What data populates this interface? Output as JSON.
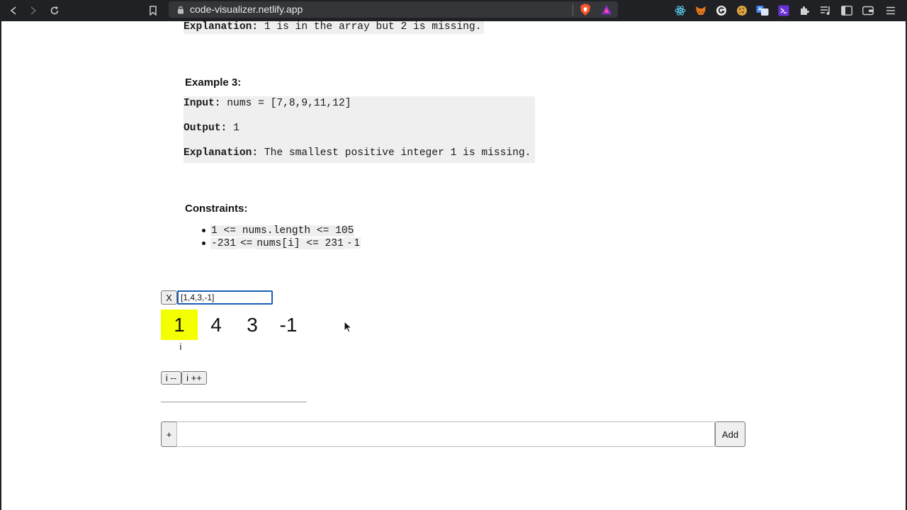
{
  "browser": {
    "url": "code-visualizer.netlify.app"
  },
  "problem": {
    "example2_explanation_label": "Explanation:",
    "example2_explanation_text": " 1 is in the array but 2 is missing.",
    "example3": {
      "heading": "Example 3:",
      "input_label": "Input:",
      "input_text": " nums = [7,8,9,11,12]",
      "output_label": "Output:",
      "output_text": " 1",
      "explanation_label": "Explanation:",
      "explanation_text": " The smallest positive integer 1 is missing."
    },
    "constraints": {
      "heading": "Constraints:",
      "items": [
        {
          "code": "1 <= nums.length <= 105",
          "suffix": ""
        },
        {
          "code": "-231",
          "mid": " <= ",
          "code2": "nums[i] <= 231",
          "suffix": " - 1"
        }
      ]
    }
  },
  "visualizer": {
    "clear_label": "X",
    "array_input_value": "[1,4,3,-1]",
    "cells": [
      "1",
      "4",
      "3",
      "-1"
    ],
    "active_index": 0,
    "pointer_label": "i",
    "decrement_label": "i --",
    "increment_label": "i ++",
    "plus_label": "+",
    "add_input_value": "",
    "add_label": "Add"
  },
  "colors": {
    "active_cell": "#f4ff00",
    "chrome_bg": "#202124",
    "focus_border": "#1a5fb4"
  }
}
